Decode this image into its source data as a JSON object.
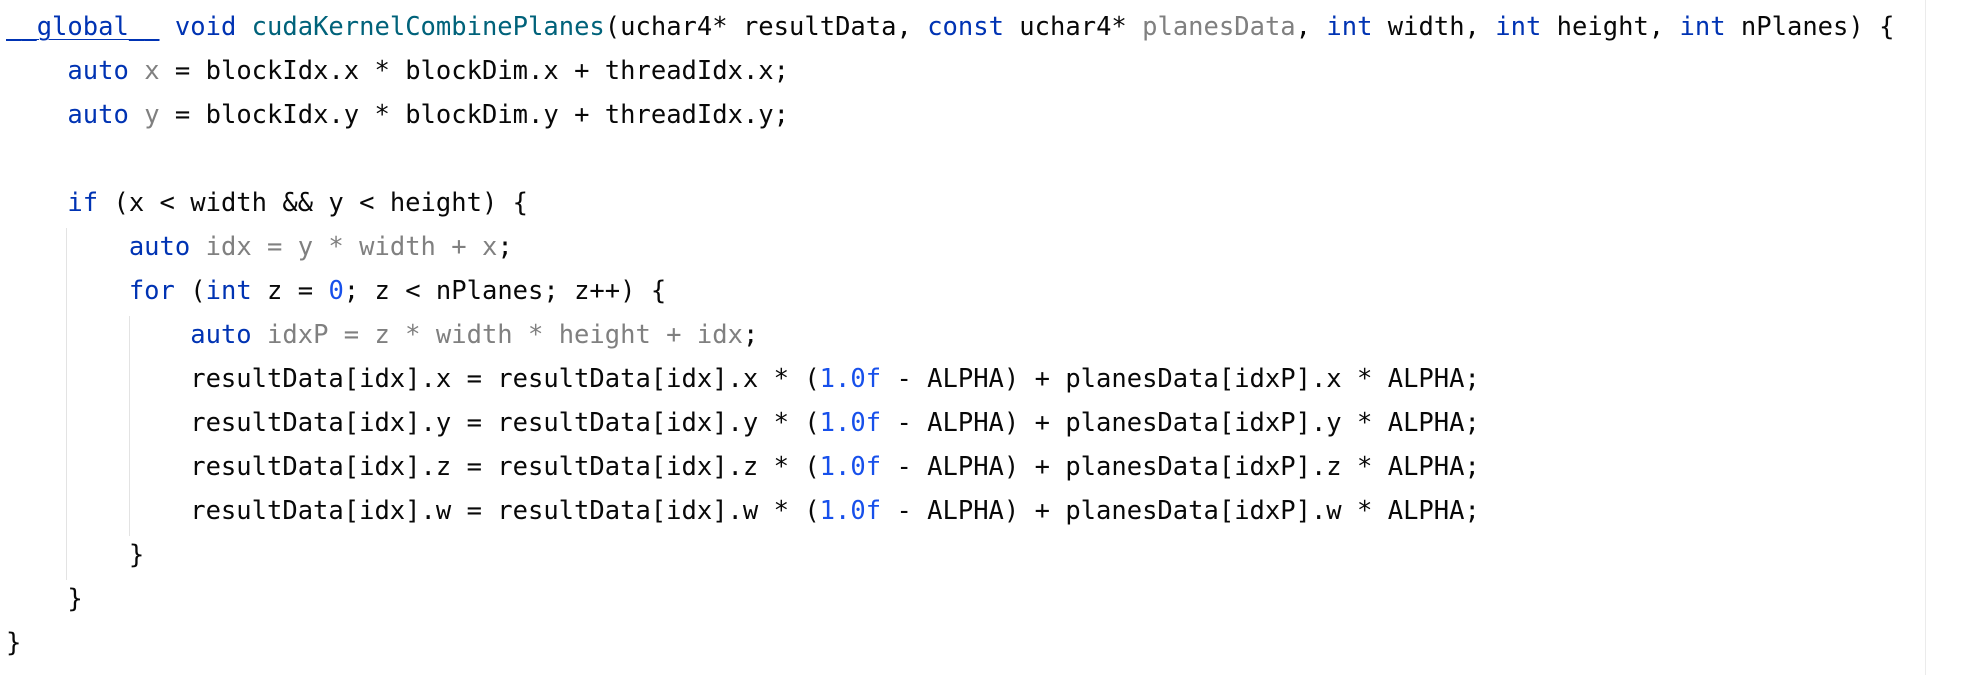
{
  "editor": {
    "language": "cuda",
    "colors": {
      "background": "#ffffff",
      "text": "#080808",
      "keyword": "#0033b3",
      "function": "#00627a",
      "number": "#1750eb",
      "unused": "#808080"
    },
    "lines": [
      [
        {
          "t": "__global__",
          "s": "global"
        },
        {
          "t": " "
        },
        {
          "t": "void",
          "s": "kw"
        },
        {
          "t": " "
        },
        {
          "t": "cudaKernelCombinePlanes",
          "s": "fn"
        },
        {
          "t": "(uchar4* resultData, "
        },
        {
          "t": "const",
          "s": "kw"
        },
        {
          "t": " uchar4* "
        },
        {
          "t": "planesData",
          "s": "unused"
        },
        {
          "t": ", "
        },
        {
          "t": "int",
          "s": "kw"
        },
        {
          "t": " width, "
        },
        {
          "t": "int",
          "s": "kw"
        },
        {
          "t": " height, "
        },
        {
          "t": "int",
          "s": "kw"
        },
        {
          "t": " nPlanes) {"
        }
      ],
      [
        {
          "t": "    "
        },
        {
          "t": "auto",
          "s": "kw"
        },
        {
          "t": " "
        },
        {
          "t": "x",
          "s": "unused"
        },
        {
          "t": " = blockIdx.x * blockDim.x + threadIdx.x;"
        }
      ],
      [
        {
          "t": "    "
        },
        {
          "t": "auto",
          "s": "kw"
        },
        {
          "t": " "
        },
        {
          "t": "y",
          "s": "unused"
        },
        {
          "t": " = blockIdx.y * blockDim.y + threadIdx.y;"
        }
      ],
      [],
      [
        {
          "t": "    "
        },
        {
          "t": "if",
          "s": "kw"
        },
        {
          "t": " (x < width && y < height) {"
        }
      ],
      [
        {
          "t": "        "
        },
        {
          "t": "auto",
          "s": "kw"
        },
        {
          "t": " "
        },
        {
          "t": "idx = y * width + x",
          "s": "unused"
        },
        {
          "t": ";"
        }
      ],
      [
        {
          "t": "        "
        },
        {
          "t": "for",
          "s": "kw"
        },
        {
          "t": " ("
        },
        {
          "t": "int",
          "s": "kw"
        },
        {
          "t": " z = "
        },
        {
          "t": "0",
          "s": "num"
        },
        {
          "t": "; z < nPlanes; z++) {"
        }
      ],
      [
        {
          "t": "            "
        },
        {
          "t": "auto",
          "s": "kw"
        },
        {
          "t": " "
        },
        {
          "t": "idxP = z * width * height + idx",
          "s": "unused"
        },
        {
          "t": ";"
        }
      ],
      [
        {
          "t": "            resultData[idx].x = resultData[idx].x * ("
        },
        {
          "t": "1.0f",
          "s": "num"
        },
        {
          "t": " - ALPHA) + planesData[idxP].x * ALPHA;"
        }
      ],
      [
        {
          "t": "            resultData[idx].y = resultData[idx].y * ("
        },
        {
          "t": "1.0f",
          "s": "num"
        },
        {
          "t": " - ALPHA) + planesData[idxP].y * ALPHA;"
        }
      ],
      [
        {
          "t": "            resultData[idx].z = resultData[idx].z * ("
        },
        {
          "t": "1.0f",
          "s": "num"
        },
        {
          "t": " - ALPHA) + planesData[idxP].z * ALPHA;"
        }
      ],
      [
        {
          "t": "            resultData[idx].w = resultData[idx].w * ("
        },
        {
          "t": "1.0f",
          "s": "num"
        },
        {
          "t": " - ALPHA) + planesData[idxP].w * ALPHA;"
        }
      ],
      [
        {
          "t": "        }"
        }
      ],
      [
        {
          "t": "    }"
        }
      ],
      [
        {
          "t": "}"
        }
      ]
    ]
  }
}
